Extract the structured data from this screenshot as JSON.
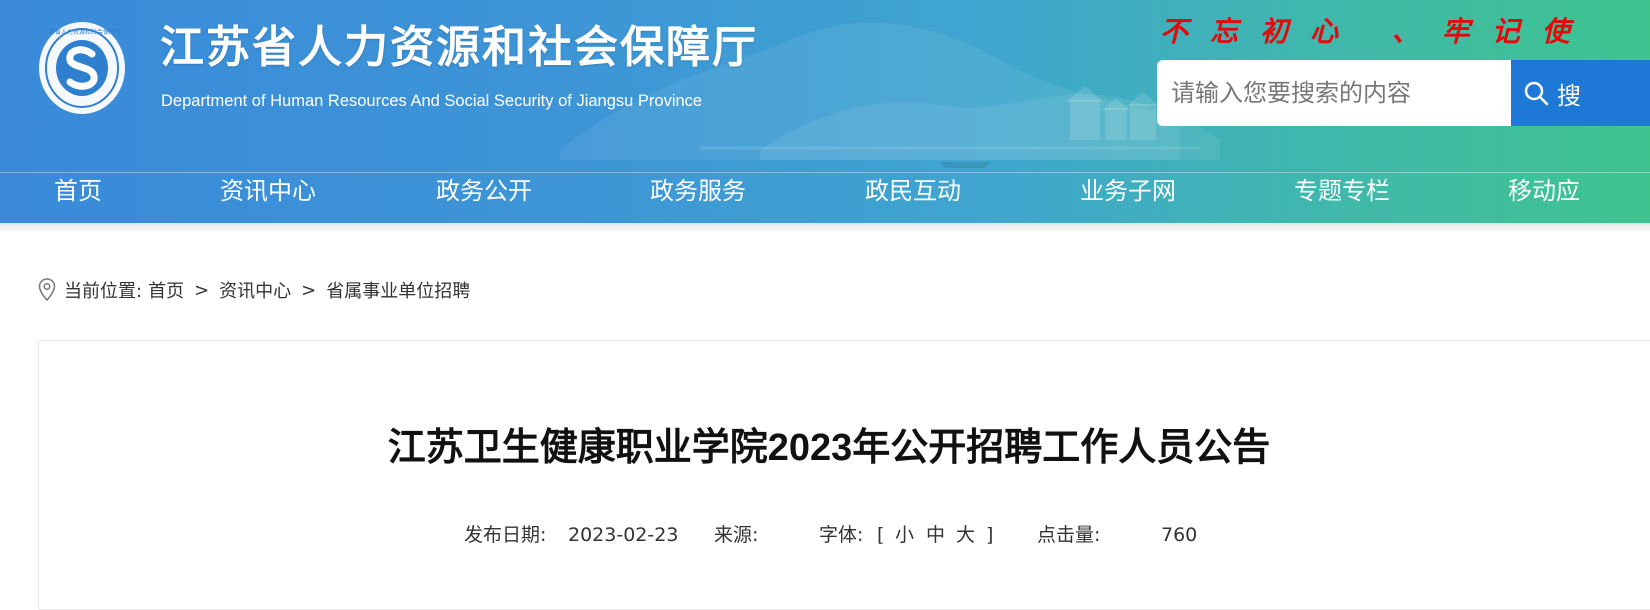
{
  "header": {
    "site_title_cn": "江苏省人力资源和社会保障厅",
    "site_title_en": "Department of Human Resources And Social Security of Jiangsu Province",
    "slogan": "不忘初心 、牢记使",
    "logo_ring_text": "江苏省人力资源和社会保障厅",
    "search": {
      "placeholder": "请输入您要搜索的内容",
      "value": "",
      "button_label": "搜"
    },
    "colors": {
      "gradient_left": "#3a8ad9",
      "gradient_right": "#3fc48f",
      "slogan": "#e10b0b",
      "search_button": "#1e78d6"
    }
  },
  "nav": {
    "items": [
      {
        "label": "首页"
      },
      {
        "label": "资讯中心"
      },
      {
        "label": "政务公开"
      },
      {
        "label": "政务服务"
      },
      {
        "label": "政民互动"
      },
      {
        "label": "业务子网"
      },
      {
        "label": "专题专栏"
      },
      {
        "label": "移动应"
      }
    ]
  },
  "breadcrumb": {
    "prefix": "当前位置:",
    "items": [
      {
        "label": "首页"
      },
      {
        "label": "资讯中心"
      },
      {
        "label": "省属事业单位招聘"
      }
    ],
    "separator": ">"
  },
  "article": {
    "title": "江苏卫生健康职业学院2023年公开招聘工作人员公告",
    "meta": {
      "date_label": "发布日期:",
      "date": "2023-02-23",
      "source_label": "来源:",
      "source": "",
      "font_label": "字体:",
      "bracket_open": "[",
      "font_small": "小",
      "font_medium": "中",
      "font_large": "大",
      "bracket_close": "]",
      "hits_label": "点击量:",
      "hits": "760"
    }
  }
}
